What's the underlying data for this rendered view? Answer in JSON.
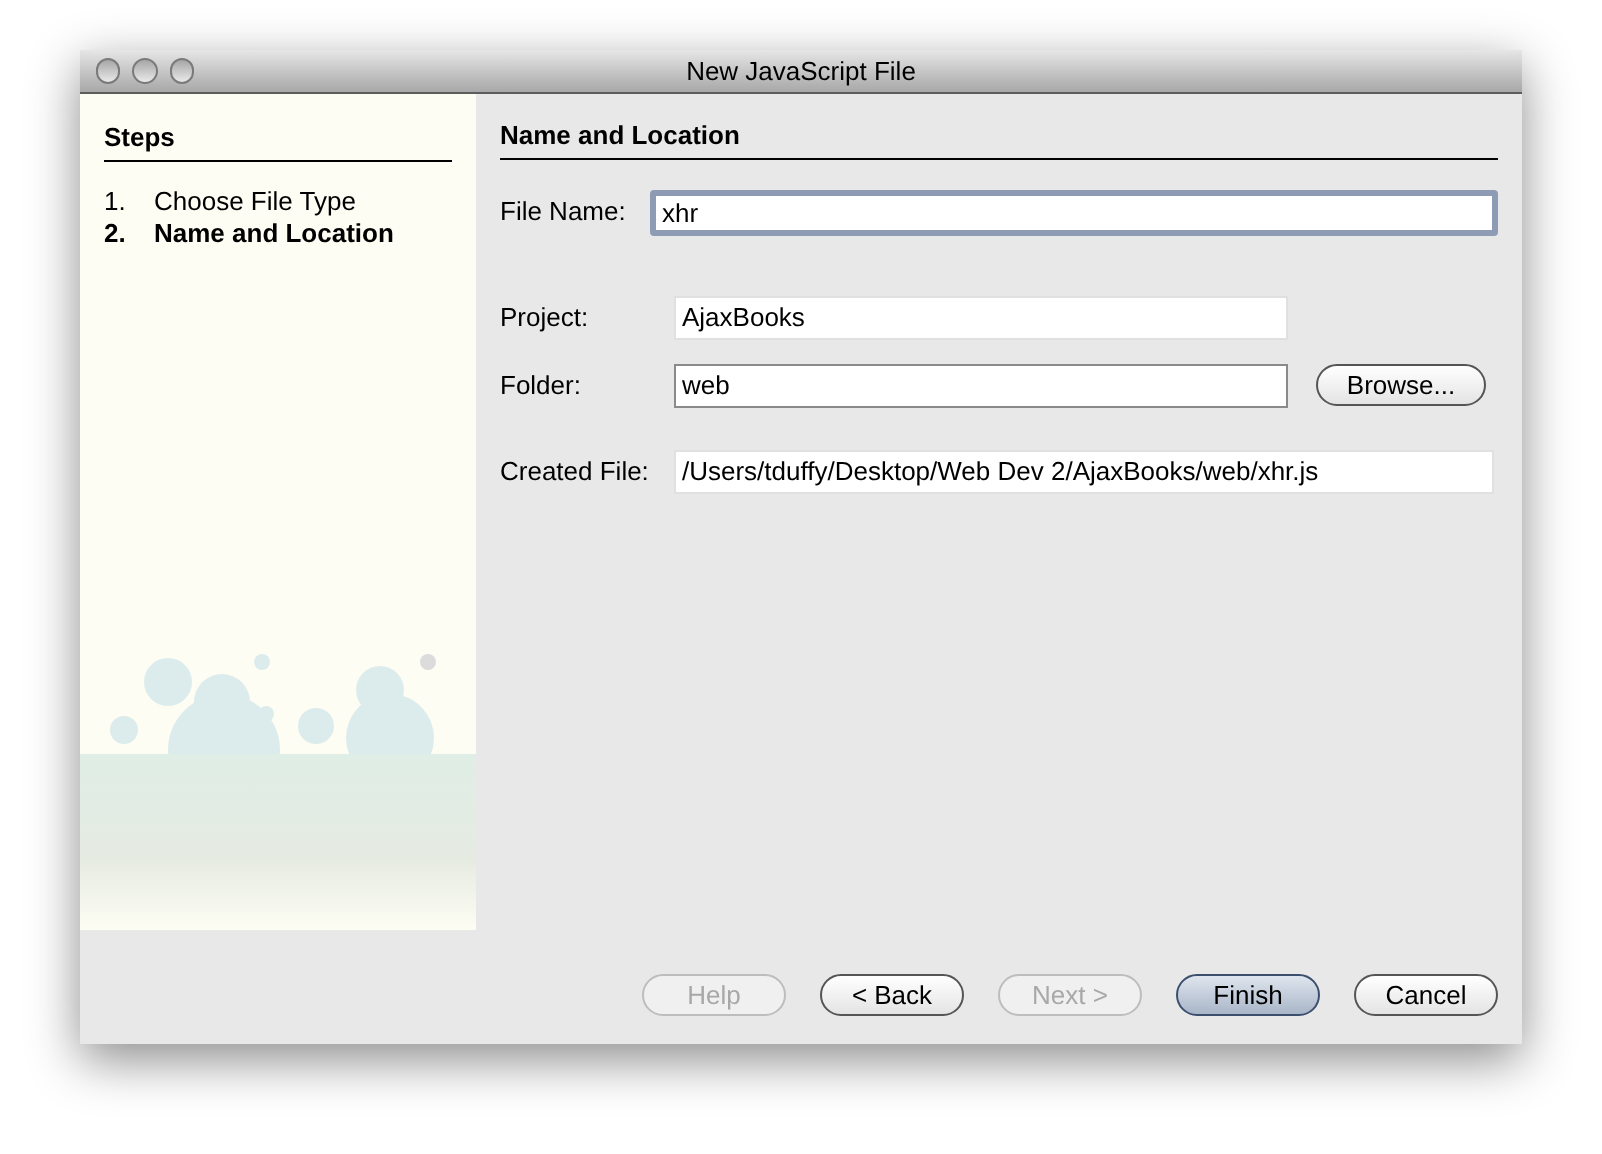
{
  "window": {
    "title": "New JavaScript File"
  },
  "steps": {
    "title": "Steps",
    "items": [
      {
        "number": "1.",
        "label": "Choose File Type",
        "selected": false
      },
      {
        "number": "2.",
        "label": "Name and Location",
        "selected": true
      }
    ]
  },
  "panel": {
    "title": "Name and Location",
    "file_name": {
      "label": "File Name:",
      "value": "xhr",
      "focused": true
    },
    "fields": [
      {
        "label": "Project:",
        "value": "AjaxBooks",
        "editable": false
      },
      {
        "label": "Folder:",
        "value": "web",
        "editable": true,
        "button": "Browse..."
      },
      {
        "label": "Created File:",
        "value": "/Users/tduffy/Desktop/Web Dev 2/AjaxBooks/web/xhr.js",
        "editable": false
      }
    ]
  },
  "buttons": [
    {
      "label": "Help",
      "disabled": true,
      "default": false
    },
    {
      "label": "< Back",
      "disabled": false,
      "default": false
    },
    {
      "label": "Next >",
      "disabled": true,
      "default": false
    },
    {
      "label": "Finish",
      "disabled": false,
      "default": true
    },
    {
      "label": "Cancel",
      "disabled": false,
      "default": false
    }
  ]
}
